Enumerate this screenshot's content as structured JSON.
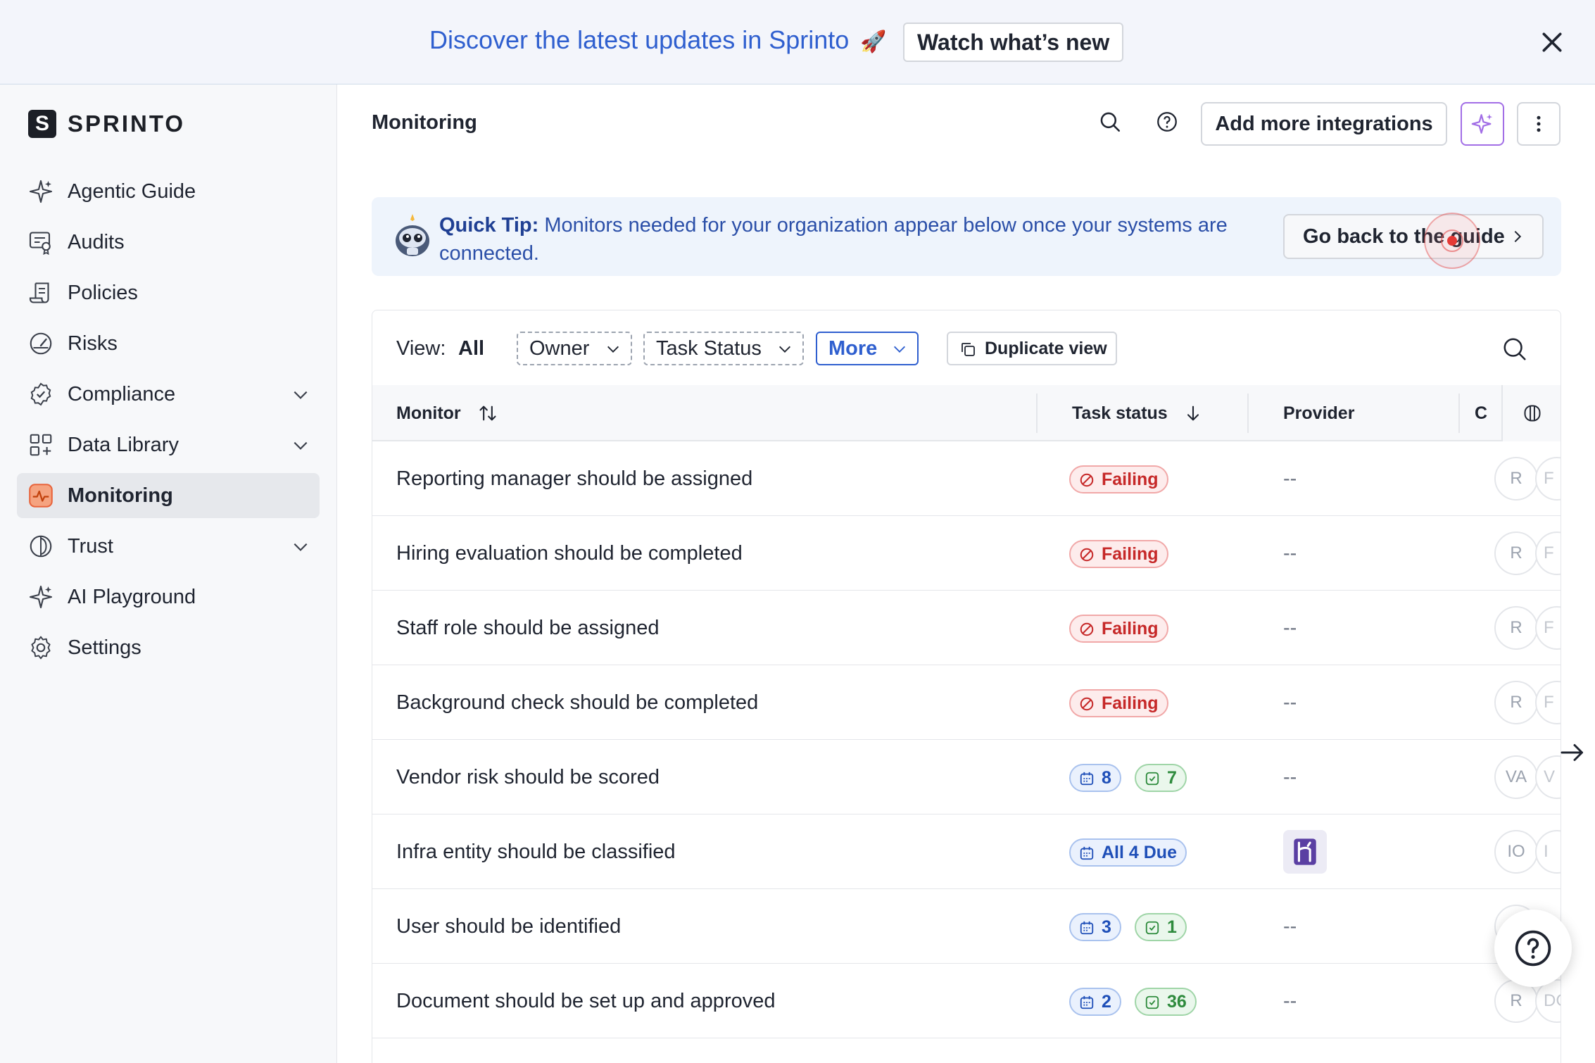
{
  "banner": {
    "text": "Discover the latest updates in Sprinto",
    "emoji": "🚀",
    "button_label": "Watch what’s new"
  },
  "sidebar": {
    "logo_letter": "S",
    "logo_text": "SPRINTO",
    "items": [
      {
        "label": "Agentic Guide",
        "icon": "sparkle-icon"
      },
      {
        "label": "Audits",
        "icon": "certificate-icon"
      },
      {
        "label": "Policies",
        "icon": "scroll-icon"
      },
      {
        "label": "Risks",
        "icon": "gauge-icon"
      },
      {
        "label": "Compliance",
        "icon": "check-badge-icon",
        "expandable": true
      },
      {
        "label": "Data Library",
        "icon": "grid-icon",
        "expandable": true
      },
      {
        "label": "Monitoring",
        "icon": "pulse-icon",
        "active": true
      },
      {
        "label": "Trust",
        "icon": "shield-icon",
        "expandable": true
      },
      {
        "label": "AI Playground",
        "icon": "sparkle-icon"
      },
      {
        "label": "Settings",
        "icon": "gear-icon"
      }
    ]
  },
  "header": {
    "title": "Monitoring",
    "add_integrations_label": "Add more integrations"
  },
  "tip": {
    "bold": "Quick Tip:",
    "text": "Monitors needed for your organization appear below once your systems are connected.",
    "button_label": "Go back to the guide"
  },
  "toolbar": {
    "view_label": "View:",
    "view_value": "All",
    "filters": [
      "Owner",
      "Task Status",
      "More"
    ],
    "duplicate_label": "Duplicate view"
  },
  "table": {
    "columns": [
      "Monitor",
      "Task status",
      "Provider",
      "C"
    ],
    "rows": [
      {
        "monitor": "Reporting manager should be assigned",
        "status": [
          {
            "type": "fail",
            "text": "Failing"
          }
        ],
        "provider": "--",
        "owner": "R",
        "owner2": "F"
      },
      {
        "monitor": "Hiring evaluation should be completed",
        "status": [
          {
            "type": "fail",
            "text": "Failing"
          }
        ],
        "provider": "--",
        "owner": "R",
        "owner2": "F"
      },
      {
        "monitor": "Staff role should be assigned",
        "status": [
          {
            "type": "fail",
            "text": "Failing"
          }
        ],
        "provider": "--",
        "owner": "R",
        "owner2": "F"
      },
      {
        "monitor": "Background check should be completed",
        "status": [
          {
            "type": "fail",
            "text": "Failing"
          }
        ],
        "provider": "--",
        "owner": "R",
        "owner2": "F"
      },
      {
        "monitor": "Vendor risk should be scored",
        "status": [
          {
            "type": "due",
            "text": "8"
          },
          {
            "type": "done",
            "text": "7"
          }
        ],
        "provider": "--",
        "owner": "VA",
        "owner2": "V"
      },
      {
        "monitor": "Infra entity should be classified",
        "status": [
          {
            "type": "due",
            "text": "All 4 Due"
          }
        ],
        "provider": "heroku-logo",
        "owner": "IO",
        "owner2": "I"
      },
      {
        "monitor": "User should be identified",
        "status": [
          {
            "type": "due",
            "text": "3"
          },
          {
            "type": "done",
            "text": "1"
          }
        ],
        "provider": "--",
        "owner": "",
        "owner2": ""
      },
      {
        "monitor": "Document should be set up and approved",
        "status": [
          {
            "type": "due",
            "text": "2"
          },
          {
            "type": "done",
            "text": "36"
          }
        ],
        "provider": "--",
        "owner": "R",
        "owner2": "DC"
      }
    ]
  },
  "colors": {
    "accent": "#2f5fcf",
    "fail": "#c62828",
    "success": "#2e8b3d",
    "ai": "#a26ee6",
    "monitoring_icon": "#e8643c"
  }
}
